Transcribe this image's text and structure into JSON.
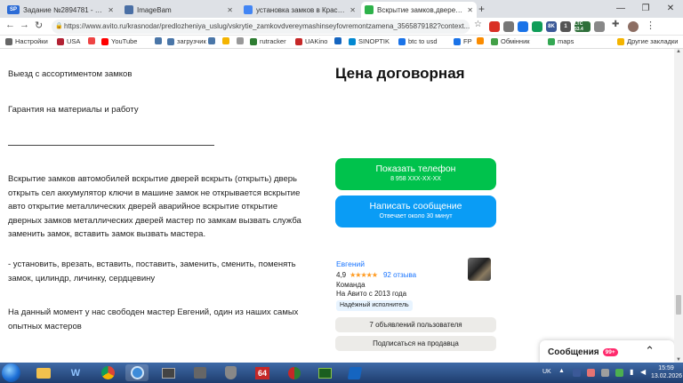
{
  "tabs": [
    {
      "favicon": "SP",
      "title": "Задание №2894781 - просмотр з",
      "color": "#2c6cd6",
      "active": false
    },
    {
      "favicon": "",
      "title": "ImageBam",
      "color": "#4a6fa5",
      "active": false
    },
    {
      "favicon": "",
      "title": "установка замков в Краснодар",
      "color": "#4285f4",
      "active": false
    },
    {
      "favicon": "",
      "title": "Вскрытие замков,дверей,машин",
      "color": "#2db24a",
      "active": true
    }
  ],
  "new_tab": "+",
  "window_controls": [
    "—",
    "❐",
    "✕"
  ],
  "address": {
    "url": "https://www.avito.ru/krasnodar/predlozheniya_uslug/vskrytie_zamkovdvereymashinseyfovremontzamena_3565879182?context..."
  },
  "extensions": [
    {
      "label": "",
      "color": "#d93025"
    },
    {
      "label": "",
      "color": "#777777"
    },
    {
      "label": "",
      "color": "#1a73e8"
    },
    {
      "label": "",
      "color": "#0f9d58"
    },
    {
      "label": "8K",
      "color": "#3b5998"
    },
    {
      "label": "1",
      "color": "#555555"
    },
    {
      "label": "LTC 53.4",
      "color": "#2f6f3a"
    },
    {
      "label": "",
      "color": "#888888"
    }
  ],
  "bookmarks": [
    {
      "label": "Настройки",
      "color": "#666666"
    },
    {
      "label": "USA",
      "color": "#b22234"
    },
    {
      "label": "",
      "color": "#e44"
    },
    {
      "label": "YouTube",
      "color": "#ff0000"
    },
    {
      "label": "",
      "color": "#4a76a8"
    },
    {
      "label": "загрузчик",
      "color": "#4a76a8"
    },
    {
      "label": "",
      "color": "#4a76a8"
    },
    {
      "label": "",
      "color": "#f4b400"
    },
    {
      "label": "",
      "color": "#999"
    },
    {
      "label": "rutracker",
      "color": "#2e7d32"
    },
    {
      "label": "UAKino",
      "color": "#c62828"
    },
    {
      "label": "",
      "color": "#1565c0"
    },
    {
      "label": "SINOPTIK",
      "color": "#0288d1"
    },
    {
      "label": "btc to usd",
      "color": "#1a73e8"
    },
    {
      "label": "FP",
      "color": "#1a73e8"
    },
    {
      "label": "",
      "color": "#fb8c00"
    },
    {
      "label": "Обмінник",
      "color": "#43a047"
    },
    {
      "label": "maps",
      "color": "#34a853"
    },
    {
      "label": "Другие закладки",
      "color": "#f4b400"
    }
  ],
  "listing": {
    "paragraphs": [
      "Выезд с ассортиментом замков",
      "Гарантия на материалы и работу",
      "Вскрытие замков автомобилей вскрытие дверей вскрыть (открыть) дверь открыть сел аккумулятор ключи в машине замок не открывается вскрытие авто открытие металлических дверей аварийное вскрытие открытие дверных замков металлических дверей мастер по замкам вызвать служба заменить замок, вставить замок вызвать мастера.",
      "- установить, врезать, вставить, поставить, заменить, сменить, поменять замок, цилиндр, личинку, сердцевину",
      "На данный момент у нас свободен мастер Евгений, один из наших самых опытных мастеров"
    ]
  },
  "sidebar": {
    "price": "Цена договорная",
    "call_button": {
      "label": "Показать телефон",
      "sub": "8 958 XXX-XX-XX"
    },
    "message_button": {
      "label": "Написать сообщение",
      "sub": "Отвечает около 30 минут"
    },
    "seller": {
      "name": "Евгений",
      "rating": "4,9",
      "stars": "★★★★★",
      "reviews": "92 отзыва",
      "type": "Команда",
      "since": "На Авито с 2013 года",
      "badge": "Надёжный исполнитель"
    },
    "listings_button": "7 объявлений пользователя",
    "subscribe_button": "Подписаться на продавца"
  },
  "chat_widget": {
    "label": "Сообщения",
    "count": "99+"
  },
  "taskbar": {
    "items": [
      {
        "label": "",
        "color": "#f2c14e"
      },
      {
        "label": "W",
        "color": "#1e6fd1"
      },
      {
        "label": "",
        "color": "#db4437"
      },
      {
        "label": "",
        "color": "#3d8bd9"
      },
      {
        "label": "",
        "color": "#444444"
      },
      {
        "label": "",
        "color": "#666666"
      },
      {
        "label": "64",
        "color": "#c62828"
      },
      {
        "label": "",
        "color": "#2e7d32"
      },
      {
        "label": "",
        "color": "#1b5e20"
      },
      {
        "label": "",
        "color": "#1565c0"
      }
    ],
    "lang": "UK",
    "time": "15:59",
    "date": "13.02.2026"
  }
}
